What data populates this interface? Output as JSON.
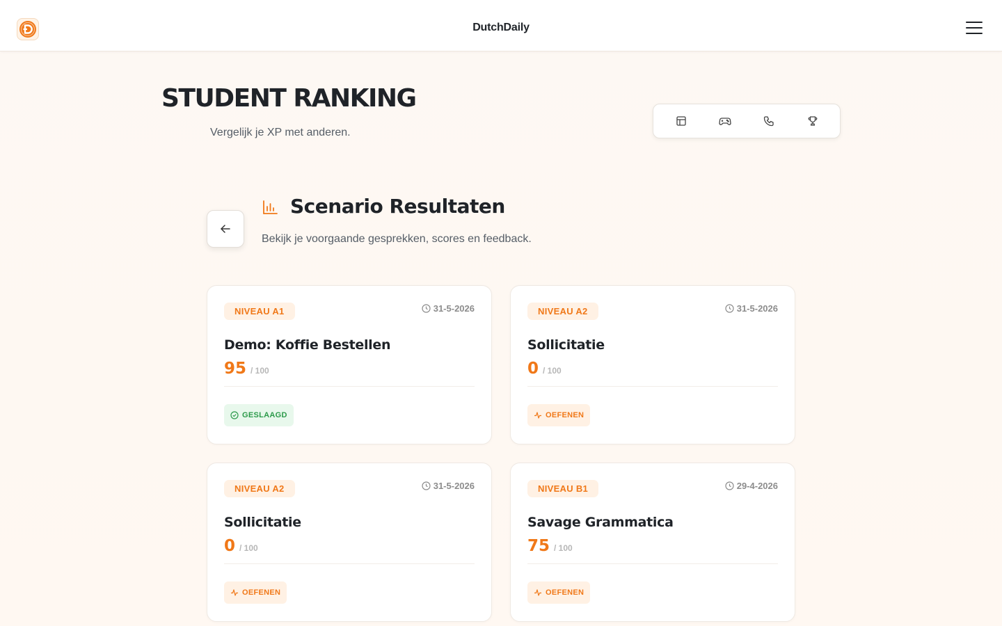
{
  "app": {
    "title": "DutchDaily"
  },
  "header": {
    "title": "STUDENT RANKING",
    "subtitle": "Vergelijk je XP met anderen."
  },
  "nav": {
    "icons": [
      "layout-icon",
      "gamepad-icon",
      "phone-icon",
      "trophy-icon"
    ]
  },
  "section": {
    "title": "Scenario Resultaten",
    "subtitle": "Bekijk je voorgaande gesprekken, scores en feedback."
  },
  "score_suffix": "/ 100",
  "cards": [
    {
      "level": "NIVEAU A1",
      "date": "31-5-2026",
      "title": "Demo: Koffie Bestellen",
      "score": "95",
      "status": "GESLAAGD",
      "status_type": "pass"
    },
    {
      "level": "NIVEAU A2",
      "date": "31-5-2026",
      "title": "Sollicitatie",
      "score": "0",
      "status": "OEFENEN",
      "status_type": "practice"
    },
    {
      "level": "NIVEAU A2",
      "date": "31-5-2026",
      "title": "Sollicitatie",
      "score": "0",
      "status": "OEFENEN",
      "status_type": "practice"
    },
    {
      "level": "NIVEAU B1",
      "date": "29-4-2026",
      "title": "Savage Grammatica",
      "score": "75",
      "status": "OEFENEN",
      "status_type": "practice"
    }
  ],
  "colors": {
    "accent": "#f07818",
    "pass": "#2c9a4a"
  }
}
